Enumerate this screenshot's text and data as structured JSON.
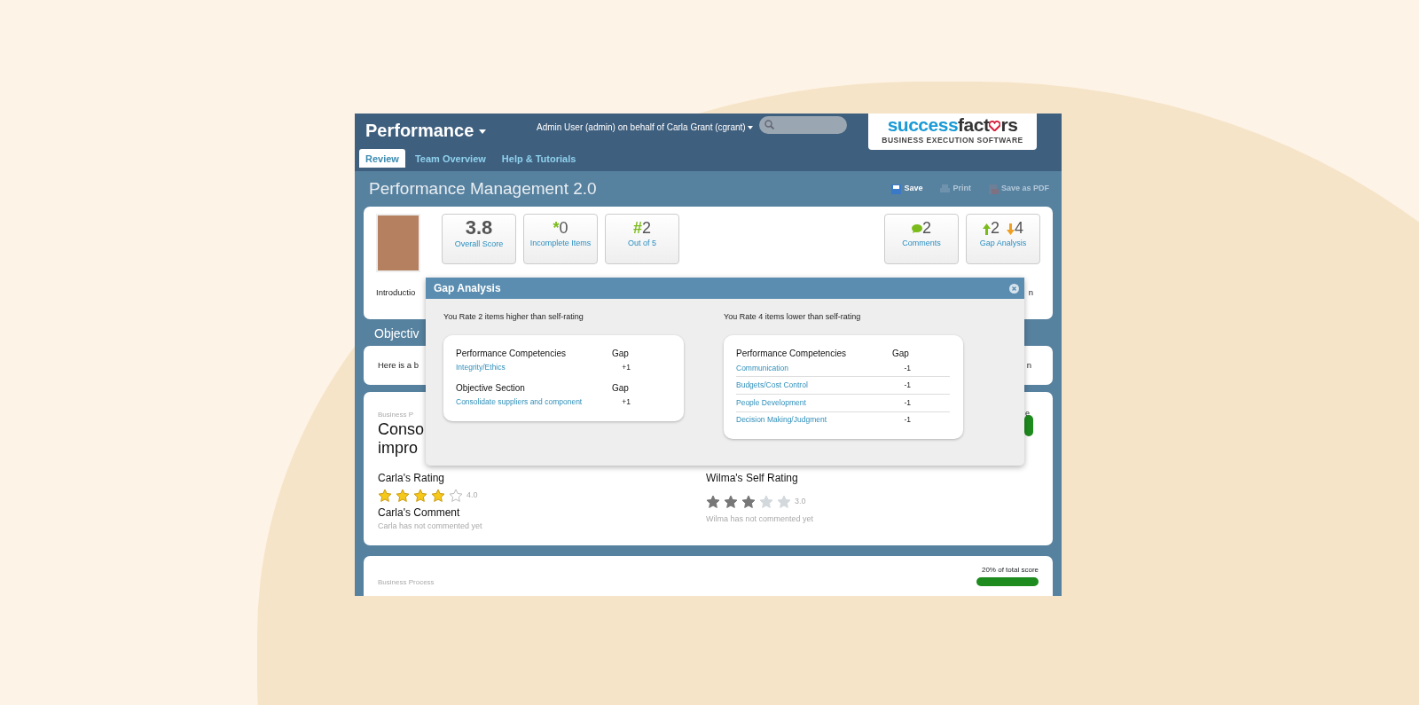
{
  "header": {
    "module": "Performance",
    "user_menu": "Admin User (admin) on behalf of Carla Grant (cgrant)",
    "logo": {
      "name_a": "success",
      "name_b": "fact",
      "name_c": "rs",
      "tagline": "BUSINESS EXECUTION SOFTWARE"
    }
  },
  "tabs": [
    {
      "label": "Review",
      "selected": true
    },
    {
      "label": "Team Overview",
      "selected": false
    },
    {
      "label": "Help & Tutorials",
      "selected": false
    }
  ],
  "page": {
    "title": "Performance Management 2.0",
    "actions": [
      {
        "kind": "save",
        "label": "Save",
        "disabled": false
      },
      {
        "kind": "print",
        "label": "Print",
        "disabled": true
      },
      {
        "kind": "pdf",
        "label": "Save as PDF",
        "disabled": true
      }
    ]
  },
  "summary": {
    "tiles": [
      {
        "kind": "score",
        "value": "3.8",
        "label": "Overall Score"
      },
      {
        "kind": "symbol",
        "symbol": "*",
        "value": "0",
        "label": "Incomplete Items"
      },
      {
        "kind": "symbol",
        "symbol": "#",
        "value": "2",
        "label": "Out of 5"
      }
    ],
    "right_tiles": [
      {
        "kind": "comments",
        "value": "2",
        "label": "Comments"
      },
      {
        "kind": "gap",
        "up": "2",
        "down": "4",
        "label": "Gap Analysis"
      }
    ],
    "intro": "Introductio",
    "intro_right": "n"
  },
  "objective_section": {
    "heading": "Objectiv",
    "text": "Here is a b",
    "text_right": "n"
  },
  "goal_card": {
    "category": "Business P",
    "title_lines": [
      "Conso",
      "impro"
    ],
    "right_fragment": "e",
    "raters": [
      {
        "kind": "manager",
        "heading": "Carla's Rating",
        "stars": 4,
        "reading": "4.0",
        "comment_heading": "Carla's Comment",
        "comment": "Carla has not commented yet"
      },
      {
        "kind": "self",
        "heading": "Wilma's Self Rating",
        "stars": 3,
        "reading": "3.0",
        "comment": "Wilma has not commented yet"
      }
    ]
  },
  "next_card": {
    "category": "Business Process",
    "weight": "20% of total score"
  },
  "gap_popup": {
    "title": "Gap Analysis",
    "panels": [
      {
        "summary": "You Rate 2 items higher than self-rating",
        "groups": [
          {
            "heading": "Performance Competencies",
            "gap_heading": "Gap",
            "items": [
              {
                "label": "Integrity/Ethics",
                "gap": "+1"
              }
            ]
          },
          {
            "heading": "Objective Section",
            "gap_heading": "Gap",
            "items": [
              {
                "label": "Consolidate suppliers and component",
                "gap": "+1"
              }
            ]
          }
        ]
      },
      {
        "summary": "You Rate 4 items lower than self-rating",
        "dividers": true,
        "groups": [
          {
            "heading": "Performance Competencies",
            "gap_heading": "Gap",
            "items": [
              {
                "label": "Communication",
                "gap": "-1"
              },
              {
                "label": "Budgets/Cost Control",
                "gap": "-1"
              },
              {
                "label": "People Development",
                "gap": "-1"
              },
              {
                "label": "Decision Making/Judgment",
                "gap": "-1"
              }
            ]
          }
        ]
      }
    ]
  }
}
